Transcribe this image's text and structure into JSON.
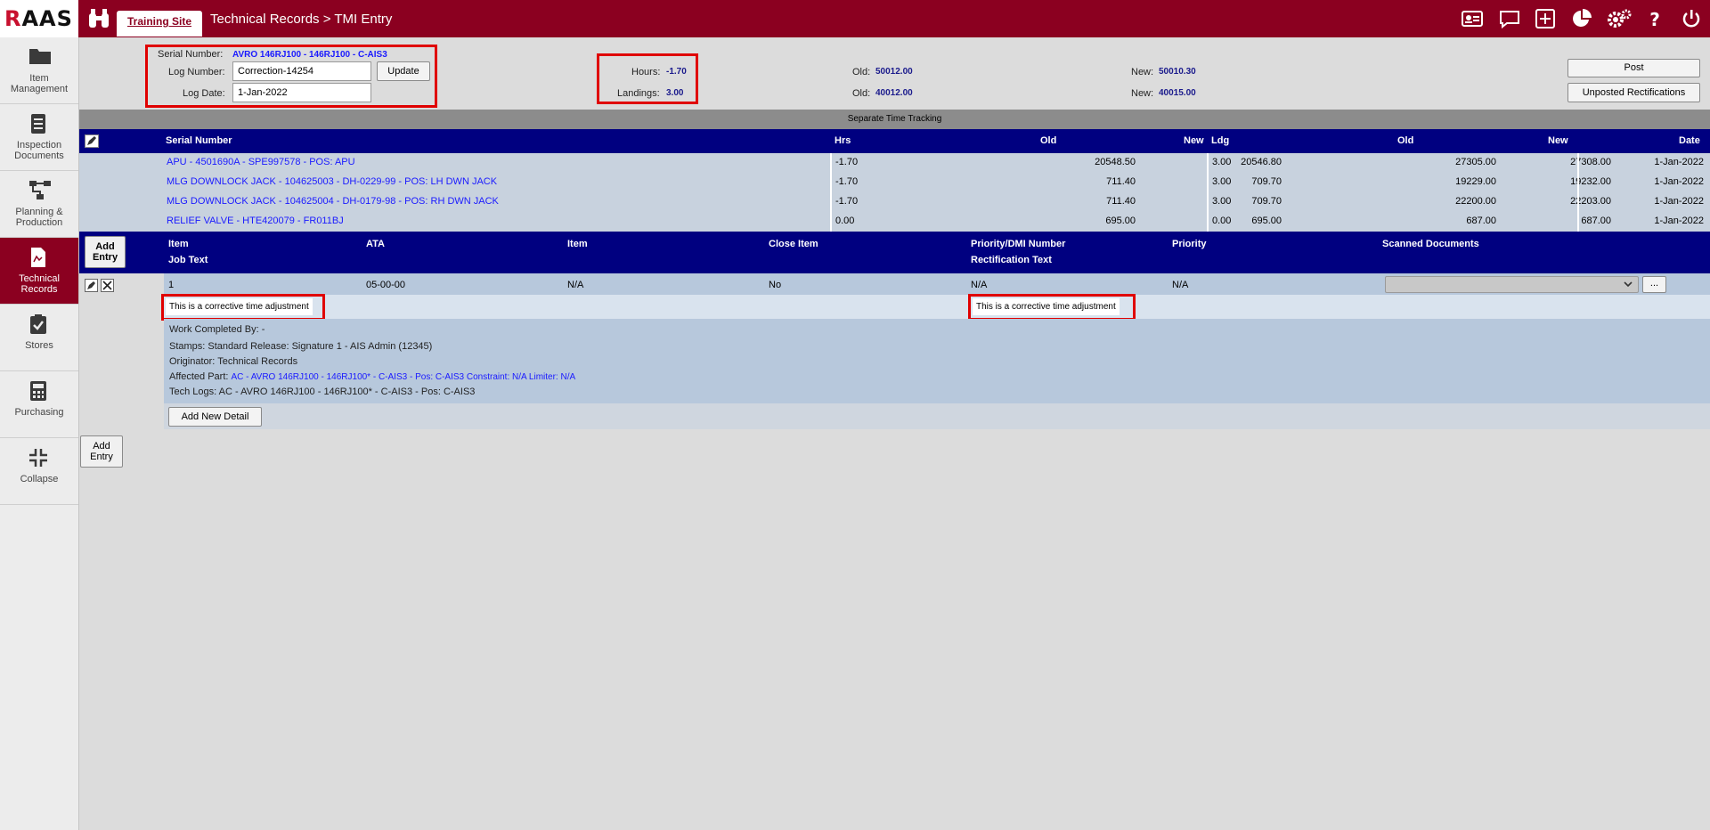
{
  "app": {
    "logo": "RAAS",
    "site_tab": "Training Site",
    "breadcrumb": "Technical Records > TMI Entry"
  },
  "topbar_icons": [
    "id-card-icon",
    "chat-icon",
    "plus-square-icon",
    "pie-chart-icon",
    "gears-icon",
    "help-icon",
    "power-icon"
  ],
  "sidebar": {
    "items": [
      {
        "label": "Item Management",
        "icon": "folder-icon"
      },
      {
        "label": "Inspection Documents",
        "icon": "document-icon"
      },
      {
        "label": "Planning & Production",
        "icon": "flow-icon"
      },
      {
        "label": "Technical Records",
        "icon": "records-icon",
        "active": true
      },
      {
        "label": "Stores",
        "icon": "clipboard-check-icon"
      },
      {
        "label": "Purchasing",
        "icon": "calculator-icon"
      },
      {
        "label": "Collapse",
        "icon": "collapse-icon"
      }
    ]
  },
  "form": {
    "serial_label": "Serial Number:",
    "serial_value": "AVRO 146RJ100 - 146RJ100 - C-AIS3",
    "log_number_label": "Log Number:",
    "log_number_value": "Correction-14254",
    "update_label": "Update",
    "log_date_label": "Log Date:",
    "log_date_value": "1-Jan-2022",
    "hours_label": "Hours:",
    "hours_value": "-1.70",
    "landings_label": "Landings:",
    "landings_value": "3.00",
    "old_label": "Old:",
    "new_label": "New:",
    "old_hours": "50012.00",
    "new_hours": "50010.30",
    "old_landings": "40012.00",
    "new_landings": "40015.00",
    "post_label": "Post",
    "unposted_label": "Unposted Rectifications"
  },
  "tracking": {
    "title": "Separate Time Tracking",
    "headers": {
      "serial": "Serial Number",
      "hrs": "Hrs",
      "old": "Old",
      "new": "New",
      "ldg": "Ldg",
      "old2": "Old",
      "new2": "New",
      "date": "Date"
    },
    "rows": [
      {
        "serial": "APU - 4501690A - SPE997578 - POS: APU",
        "hrs": "-1.70",
        "old": "20548.50",
        "new": "20546.80",
        "ldg": "3.00",
        "old2": "27305.00",
        "new2": "27308.00",
        "date": "1-Jan-2022"
      },
      {
        "serial": "MLG DOWNLOCK JACK - 104625003 - DH-0229-99 - POS: LH DWN JACK",
        "hrs": "-1.70",
        "old": "711.40",
        "new": "709.70",
        "ldg": "3.00",
        "old2": "19229.00",
        "new2": "19232.00",
        "date": "1-Jan-2022"
      },
      {
        "serial": "MLG DOWNLOCK JACK - 104625004 - DH-0179-98 - POS: RH DWN JACK",
        "hrs": "-1.70",
        "old": "711.40",
        "new": "709.70",
        "ldg": "3.00",
        "old2": "22200.00",
        "new2": "22203.00",
        "date": "1-Jan-2022"
      },
      {
        "serial": "RELIEF VALVE - HTE420079 - FR011BJ",
        "hrs": "0.00",
        "old": "695.00",
        "new": "695.00",
        "ldg": "0.00",
        "old2": "687.00",
        "new2": "687.00",
        "date": "1-Jan-2022"
      }
    ]
  },
  "entries": {
    "add_entry_top": "Add Entry",
    "add_entry_bottom": "Add Entry",
    "headers": {
      "item": "Item",
      "job_text": "Job Text",
      "ata": "ATA",
      "item2": "Item",
      "close_item": "Close Item",
      "priority_dmi": "Priority/DMI Number",
      "rect_text": "Rectification Text",
      "priority": "Priority",
      "scanned": "Scanned Documents"
    },
    "row": {
      "item": "1",
      "ata": "05-00-00",
      "item2": "N/A",
      "close_item": "No",
      "priority_dmi": "N/A",
      "priority": "N/A",
      "job_text": "This is a corrective time adjustment",
      "rect_text": "This is a corrective time adjustment",
      "ellipsis": "..."
    },
    "detail": {
      "work_completed": "Work Completed By: -",
      "stamps": "Stamps: Standard Release: Signature 1 - AIS Admin (12345)",
      "originator": "Originator: Technical Records",
      "affected_label": "Affected Part:",
      "affected_value": "AC - AVRO 146RJ100 - 146RJ100* - C-AIS3 - Pos: C-AIS3 Constraint: N/A Limiter: N/A",
      "tech_logs": "Tech Logs: AC - AVRO 146RJ100 - 146RJ100* - C-AIS3 - Pos: C-AIS3"
    },
    "add_new_detail": "Add New Detail"
  }
}
